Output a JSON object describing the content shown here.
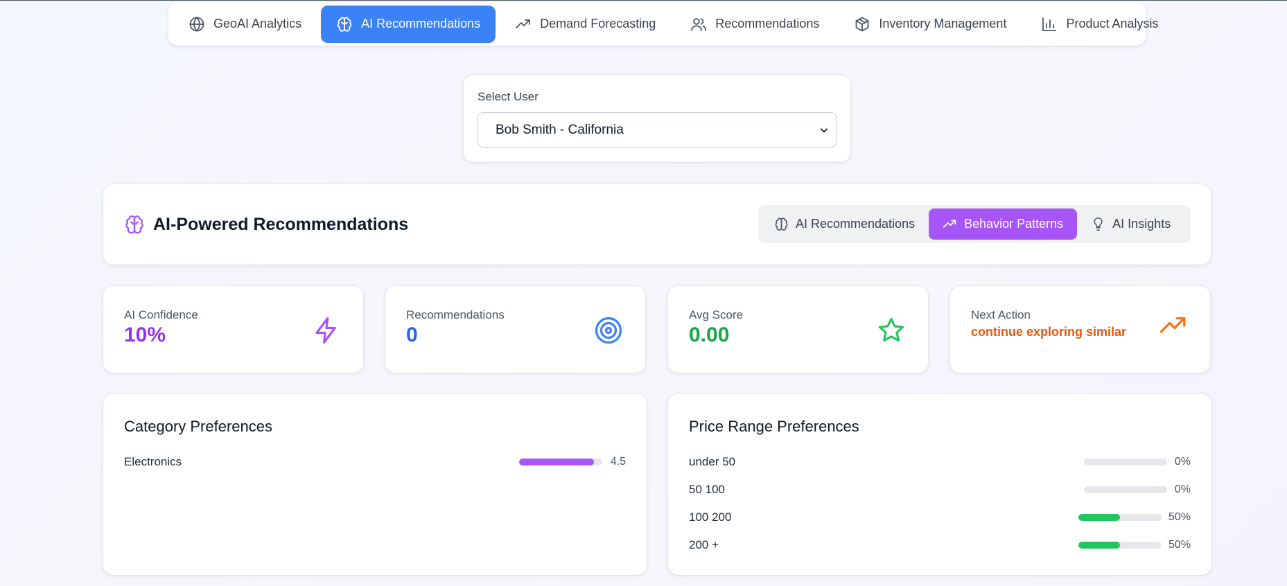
{
  "nav": {
    "items": [
      {
        "label": "GeoAI Analytics",
        "icon": "globe-icon",
        "active": false
      },
      {
        "label": "AI Recommendations",
        "icon": "brain-icon",
        "active": true
      },
      {
        "label": "Demand Forecasting",
        "icon": "trending-up-icon",
        "active": false
      },
      {
        "label": "Recommendations",
        "icon": "users-icon",
        "active": false
      },
      {
        "label": "Inventory Management",
        "icon": "package-icon",
        "active": false
      },
      {
        "label": "Product Analysis",
        "icon": "bar-chart-icon",
        "active": false
      }
    ]
  },
  "user_select": {
    "label": "Select User",
    "value": "Bob Smith - California"
  },
  "header": {
    "title": "AI-Powered Recommendations",
    "tabs": [
      {
        "label": "AI Recommendations",
        "icon": "brain-icon",
        "active": false
      },
      {
        "label": "Behavior Patterns",
        "icon": "trending-up-icon",
        "active": true
      },
      {
        "label": "AI Insights",
        "icon": "lightbulb-icon",
        "active": false
      }
    ]
  },
  "stats": {
    "confidence": {
      "label": "AI Confidence",
      "value": "10%",
      "color": "#9333ea",
      "icon": "zap-icon"
    },
    "recommendations": {
      "label": "Recommendations",
      "value": "0",
      "color": "#2563eb",
      "icon": "target-icon"
    },
    "avg_score": {
      "label": "Avg Score",
      "value": "0.00",
      "color": "#16a34a",
      "icon": "star-icon"
    },
    "next_action": {
      "label": "Next Action",
      "value": "continue exploring similar",
      "color": "#ea580c",
      "icon": "trending-up-icon"
    }
  },
  "category_prefs": {
    "title": "Category Preferences",
    "items": [
      {
        "name": "Electronics",
        "value": "4.5",
        "fraction": 0.9,
        "color": "#a855f7"
      }
    ]
  },
  "price_prefs": {
    "title": "Price Range Preferences",
    "items": [
      {
        "name": "under 50",
        "value": "0%",
        "fraction": 0,
        "color": "#22c55e"
      },
      {
        "name": "50 100",
        "value": "0%",
        "fraction": 0,
        "color": "#22c55e"
      },
      {
        "name": "100 200",
        "value": "50%",
        "fraction": 0.5,
        "color": "#22c55e"
      },
      {
        "name": "200 +",
        "value": "50%",
        "fraction": 0.5,
        "color": "#22c55e"
      }
    ]
  }
}
